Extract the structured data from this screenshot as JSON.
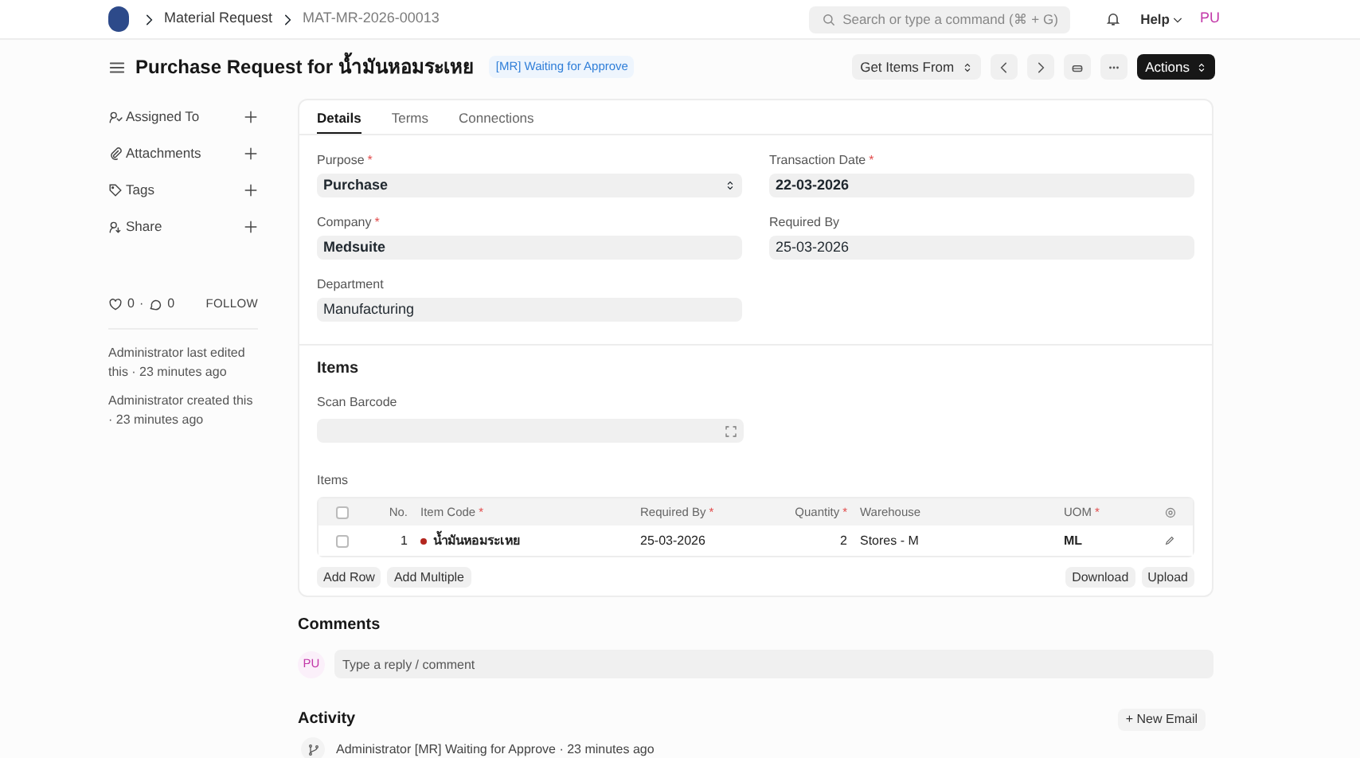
{
  "breadcrumbs": [
    "Material Request",
    "MAT-MR-2026-00013"
  ],
  "search": {
    "placeholder": "Search or type a command (⌘ + G)"
  },
  "help": "Help",
  "avatar": "PU",
  "title": "Purchase Request for น้ำมันหอมระเหย",
  "status": "[MR] Waiting for Approve",
  "toolbar": {
    "get_items": "Get Items From",
    "actions": "Actions"
  },
  "sidebar": {
    "items": [
      "Assigned To",
      "Attachments",
      "Tags",
      "Share"
    ],
    "likes": "0",
    "comments": "0",
    "separator": "·",
    "follow": "FOLLOW",
    "log": [
      "Administrator last edited this · 23 minutes ago",
      "Administrator created this · 23 minutes ago"
    ]
  },
  "tabs": [
    {
      "label": "Details",
      "selected": true
    },
    {
      "label": "Terms",
      "selected": false
    },
    {
      "label": "Connections",
      "selected": false
    }
  ],
  "fields_left": [
    {
      "label": "Purpose",
      "mark": "*",
      "value": "Purchase",
      "kind": "select"
    },
    {
      "label": "Company",
      "mark": "*",
      "value": "Medsuite",
      "kind": "text"
    },
    {
      "label": "Department",
      "value": "Manufacturing",
      "kind": "text"
    }
  ],
  "fields_right": [
    {
      "label": "Transaction Date",
      "mark": "*",
      "value": "22-03-2026"
    },
    {
      "label": "Required By",
      "value": "25-03-2026"
    }
  ],
  "items_section": {
    "title": "Items",
    "scan_label": "Scan Barcode",
    "table_label": "Items",
    "select_all_checked": false,
    "columns": [
      {
        "label": "No."
      },
      {
        "label": "Item Code",
        "mark": "*"
      },
      {
        "label": "Required By",
        "mark": "*"
      },
      {
        "label": "Quantity",
        "mark": "*"
      },
      {
        "label": "Warehouse"
      },
      {
        "label": "UOM",
        "mark": "*"
      }
    ],
    "rows": [
      {
        "checked": false,
        "no": "1",
        "item_code": "น้ำมันหอมระเหย",
        "color": "#b3261e",
        "required_by": "25-03-2026",
        "quantity": "2",
        "warehouse": "Stores - M",
        "uom": "ML"
      }
    ],
    "buttons_left": [
      "Add Row",
      "Add Multiple"
    ],
    "buttons_right": [
      "Download",
      "Upload"
    ]
  },
  "comments": {
    "title": "Comments",
    "avatar": "PU",
    "placeholder": "Type a reply / comment"
  },
  "activity": {
    "title": "Activity",
    "new_email": "+ New Email",
    "entries": [
      "Administrator [MR] Waiting for Approve · 23 minutes ago"
    ]
  }
}
